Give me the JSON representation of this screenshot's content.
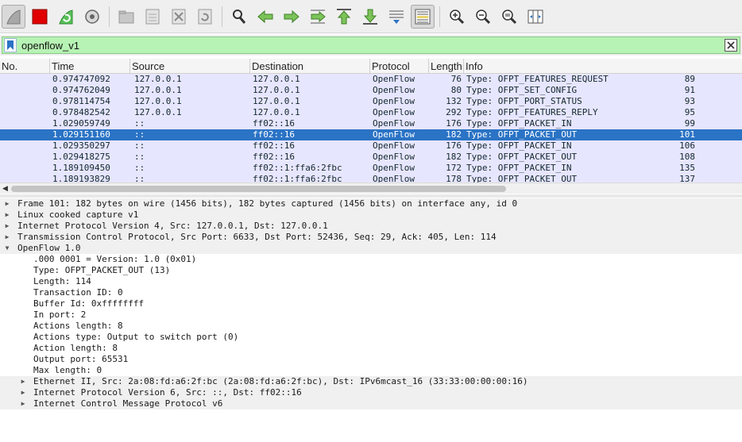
{
  "toolbar": {
    "buttons": [
      "shark-fin-icon",
      "stop-icon",
      "restart-icon",
      "capture-options-icon",
      "open-file-icon",
      "save-file-icon",
      "close-file-icon",
      "reload-file-icon",
      "find-packet-icon",
      "go-back-icon",
      "go-forward-icon",
      "go-to-packet-icon",
      "go-first-icon",
      "go-last-icon",
      "autoscroll-icon",
      "colorize-icon",
      "zoom-in-icon",
      "zoom-out-icon",
      "normal-size-icon",
      "resize-columns-icon"
    ]
  },
  "filter": {
    "value": "openflow_v1"
  },
  "packet_list": {
    "columns": [
      "No.",
      "Time",
      "Source",
      "Destination",
      "Protocol",
      "Length",
      "Info"
    ],
    "rows": [
      {
        "no": "89",
        "time": "0.974747092",
        "src": "127.0.0.1",
        "dst": "127.0.0.1",
        "proto": "OpenFlow",
        "len": "76",
        "info": "Type: OFPT_FEATURES_REQUEST"
      },
      {
        "no": "91",
        "time": "0.974762049",
        "src": "127.0.0.1",
        "dst": "127.0.0.1",
        "proto": "OpenFlow",
        "len": "80",
        "info": "Type: OFPT_SET_CONFIG"
      },
      {
        "no": "93",
        "time": "0.978114754",
        "src": "127.0.0.1",
        "dst": "127.0.0.1",
        "proto": "OpenFlow",
        "len": "132",
        "info": "Type: OFPT_PORT_STATUS"
      },
      {
        "no": "95",
        "time": "0.978482542",
        "src": "127.0.0.1",
        "dst": "127.0.0.1",
        "proto": "OpenFlow",
        "len": "292",
        "info": "Type: OFPT_FEATURES_REPLY"
      },
      {
        "no": "99",
        "time": "1.029059749",
        "src": "::",
        "dst": "ff02::16",
        "proto": "OpenFlow",
        "len": "176",
        "info": "Type: OFPT_PACKET_IN"
      },
      {
        "no": "101",
        "time": "1.029151160",
        "src": "::",
        "dst": "ff02::16",
        "proto": "OpenFlow",
        "len": "182",
        "info": "Type: OFPT_PACKET_OUT"
      },
      {
        "no": "106",
        "time": "1.029350297",
        "src": "::",
        "dst": "ff02::16",
        "proto": "OpenFlow",
        "len": "176",
        "info": "Type: OFPT_PACKET_IN"
      },
      {
        "no": "108",
        "time": "1.029418275",
        "src": "::",
        "dst": "ff02::16",
        "proto": "OpenFlow",
        "len": "182",
        "info": "Type: OFPT_PACKET_OUT"
      },
      {
        "no": "135",
        "time": "1.189109450",
        "src": "::",
        "dst": "ff02::1:ffa6:2fbc",
        "proto": "OpenFlow",
        "len": "172",
        "info": "Type: OFPT_PACKET_IN"
      },
      {
        "no": "137",
        "time": "1.189193829",
        "src": "::",
        "dst": "ff02::1:ffa6:2fbc",
        "proto": "OpenFlow",
        "len": "178",
        "info": "Type: OFPT_PACKET_OUT"
      }
    ],
    "selected_row": "101",
    "colors": {
      "row_bg": "#e7e6ff",
      "selected_bg": "#2a73c5"
    }
  },
  "details": {
    "items": [
      {
        "text": "Frame 101: 182 bytes on wire (1456 bits), 182 bytes captured (1456 bits) on interface any, id 0",
        "expander": "collapsed"
      },
      {
        "text": "Linux cooked capture v1",
        "expander": "collapsed"
      },
      {
        "text": "Internet Protocol Version 4, Src: 127.0.0.1, Dst: 127.0.0.1",
        "expander": "collapsed"
      },
      {
        "text": "Transmission Control Protocol, Src Port: 6633, Dst Port: 52436, Seq: 29, Ack: 405, Len: 114",
        "expander": "collapsed"
      },
      {
        "text": "OpenFlow 1.0",
        "expander": "expanded"
      },
      {
        "text": ".000 0001 = Version: 1.0 (0x01)",
        "expander": "none"
      },
      {
        "text": "Type: OFPT_PACKET_OUT (13)",
        "expander": "none"
      },
      {
        "text": "Length: 114",
        "expander": "none"
      },
      {
        "text": "Transaction ID: 0",
        "expander": "none"
      },
      {
        "text": "Buffer Id: 0xffffffff",
        "expander": "none"
      },
      {
        "text": "In port: 2",
        "expander": "none"
      },
      {
        "text": "Actions length: 8",
        "expander": "none"
      },
      {
        "text": "Actions type: Output to switch port (0)",
        "expander": "none"
      },
      {
        "text": "Action length: 8",
        "expander": "none"
      },
      {
        "text": "Output port: 65531",
        "expander": "none"
      },
      {
        "text": "Max length: 0",
        "expander": "none"
      },
      {
        "text": "Ethernet II, Src: 2a:08:fd:a6:2f:bc (2a:08:fd:a6:2f:bc), Dst: IPv6mcast_16 (33:33:00:00:00:16)",
        "expander": "collapsed"
      },
      {
        "text": "Internet Protocol Version 6, Src: ::, Dst: ff02::16",
        "expander": "collapsed"
      },
      {
        "text": "Internet Control Message Protocol v6",
        "expander": "collapsed"
      }
    ]
  }
}
